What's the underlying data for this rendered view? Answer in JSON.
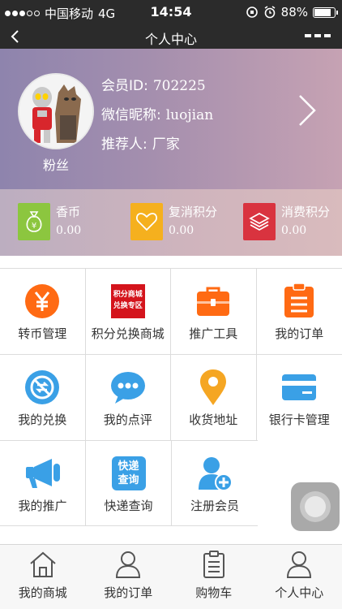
{
  "status_bar": {
    "carrier": "中国移动",
    "network": "4G",
    "time": "14:54",
    "battery_text": "88%",
    "battery_level": 0.88
  },
  "nav": {
    "title": "个人中心"
  },
  "profile": {
    "member_id_label": "会员ID:",
    "member_id": "702225",
    "nickname_label": "微信昵称:",
    "nickname": "luojian",
    "referrer_label": "推荐人:",
    "referrer": "厂家",
    "avatar_caption": "粉丝"
  },
  "points": [
    {
      "label": "香币",
      "value": "0.00",
      "icon": "money-bag-icon",
      "color": "#8cc63f"
    },
    {
      "label": "复消积分",
      "value": "0.00",
      "icon": "heart-icon",
      "color": "#f5b01e"
    },
    {
      "label": "消费积分",
      "value": "0.00",
      "icon": "layers-icon",
      "color": "#d9333f"
    }
  ],
  "grid": [
    [
      {
        "label": "转币管理",
        "icon": "yen-icon"
      },
      {
        "label": "积分兑换商城",
        "icon": "points-mall-icon",
        "icon_text_1": "积分商城",
        "icon_text_2": "兑换专区"
      },
      {
        "label": "推广工具",
        "icon": "toolbox-icon"
      },
      {
        "label": "我的订单",
        "icon": "clipboard-icon"
      }
    ],
    [
      {
        "label": "我的兑换",
        "icon": "exchange-icon"
      },
      {
        "label": "我的点评",
        "icon": "comment-icon"
      },
      {
        "label": "收货地址",
        "icon": "location-icon"
      },
      {
        "label": "银行卡管理",
        "icon": "bank-card-icon"
      }
    ],
    [
      {
        "label": "我的推广",
        "icon": "megaphone-icon"
      },
      {
        "label": "快递查询",
        "icon": "express-query-icon",
        "icon_text_1": "快递",
        "icon_text_2": "查询"
      },
      {
        "label": "注册会员",
        "icon": "add-user-icon"
      }
    ]
  ],
  "tab_bar": [
    {
      "label": "我的商城",
      "icon": "home-icon"
    },
    {
      "label": "我的订单",
      "icon": "user-icon"
    },
    {
      "label": "购物车",
      "icon": "list-icon"
    },
    {
      "label": "个人中心",
      "icon": "user-icon"
    }
  ],
  "colors": {
    "dark_bar": "#2b2b2b",
    "orange": "#ff6a13",
    "blue": "#3aa0e6",
    "yellow": "#f5a623"
  }
}
